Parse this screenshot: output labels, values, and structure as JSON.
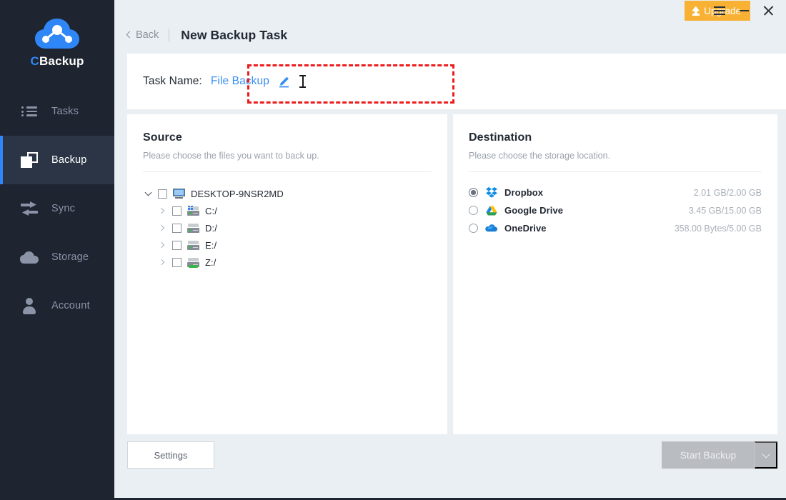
{
  "app": {
    "brand_prefix": "C",
    "brand_suffix": "Backup",
    "accent_color": "#2f86f6",
    "sidebar_bg": "#1e2430",
    "logo_icon": "cloud-network-logo"
  },
  "sidebar": {
    "items": [
      {
        "label": "Tasks",
        "icon": "list-icon",
        "active": false
      },
      {
        "label": "Backup",
        "icon": "stacked-squares-icon",
        "active": true
      },
      {
        "label": "Sync",
        "icon": "sync-arrows-icon",
        "active": false
      },
      {
        "label": "Storage",
        "icon": "cloud-icon",
        "active": false
      },
      {
        "label": "Account",
        "icon": "person-icon",
        "active": false
      }
    ]
  },
  "titlebar": {
    "upgrade_label": "Upgrade",
    "upgrade_icon": "upload-arrow-icon",
    "upgrade_color": "#f8b133",
    "menu_icon": "hamburger-icon",
    "minimize_icon": "minimize-icon",
    "close_icon": "close-icon"
  },
  "header": {
    "back_label": "Back",
    "back_icon": "chevron-left-icon",
    "title": "New Backup Task"
  },
  "task_name": {
    "label": "Task Name:",
    "value": "File Backup",
    "edit_icon": "pencil-icon",
    "cursor_icon": "text-cursor-icon",
    "highlight_color": "#ee1b1b"
  },
  "source": {
    "title": "Source",
    "subtitle": "Please choose the files you want to back up.",
    "root": {
      "label": "DESKTOP-9NSR2MD",
      "icon": "monitor-icon",
      "expanded": true,
      "checked": false
    },
    "children": [
      {
        "label": "C:/",
        "icon": "drive-system-icon",
        "expanded": false,
        "checked": false
      },
      {
        "label": "D:/",
        "icon": "drive-icon",
        "expanded": false,
        "checked": false
      },
      {
        "label": "E:/",
        "icon": "drive-icon",
        "expanded": false,
        "checked": false
      },
      {
        "label": "Z:/",
        "icon": "drive-network-icon",
        "expanded": false,
        "checked": false
      }
    ]
  },
  "destination": {
    "title": "Destination",
    "subtitle": "Please choose the storage location.",
    "options": [
      {
        "name": "Dropbox",
        "icon": "dropbox-icon",
        "quota": "2.01 GB/2.00 GB",
        "selected": true
      },
      {
        "name": "Google Drive",
        "icon": "googledrive-icon",
        "quota": "3.45 GB/15.00 GB",
        "selected": false
      },
      {
        "name": "OneDrive",
        "icon": "onedrive-icon",
        "quota": "358.00 Bytes/5.00 GB",
        "selected": false
      }
    ]
  },
  "footer": {
    "settings_label": "Settings",
    "start_backup_label": "Start Backup",
    "start_backup_enabled": false,
    "dropdown_icon": "chevron-down-icon"
  }
}
